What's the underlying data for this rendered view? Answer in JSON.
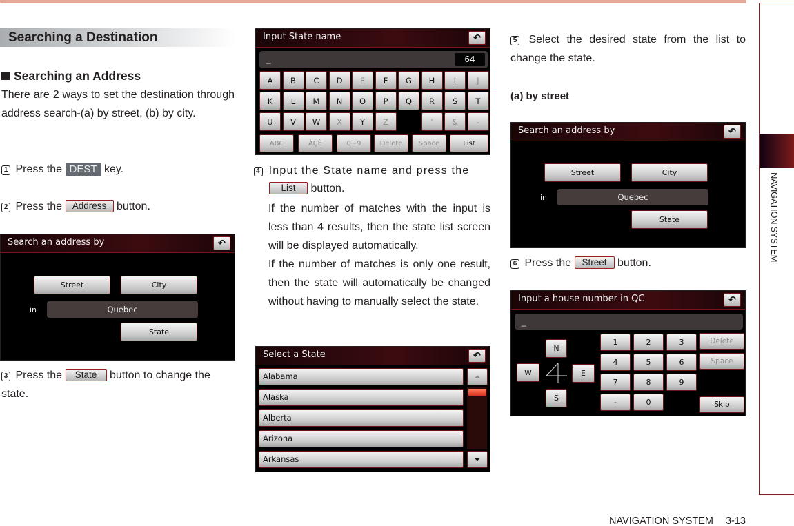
{
  "page": {
    "section_title": "Searching a Destination",
    "sub_heading": "Searching an Address",
    "intro": "There are 2 ways to set the destination through address search-(a) by street, (b) by city.",
    "side_label": "NAVIGATION SYSTEM",
    "footer": {
      "section": "NAVIGATION SYSTEM",
      "page": "3-13"
    },
    "accent_color": "#8b1a1a",
    "top_bar_color": "#e2a998"
  },
  "steps": [
    {
      "num": "1",
      "pre": "Press the",
      "key": "DEST",
      "post": "key."
    },
    {
      "num": "2",
      "pre": "Press the",
      "key": "Address",
      "post": "button."
    },
    {
      "num": "3",
      "pre": "Press the",
      "key": "State",
      "post": "button to change the state."
    },
    {
      "num": "4",
      "pre": "Input the State name and press the",
      "key": "List",
      "post": "button.",
      "note1": "If the number of matches with the input is less than 4 results, then the state list screen will be displayed automatically.",
      "note2": "If the number of matches is only one result, then the state will automatically be changed without having to manually select the state."
    },
    {
      "num": "5",
      "text": "Select the desired state from the list to change the state."
    },
    {
      "num": "6",
      "pre": "Press the",
      "key": "Street",
      "post": "button."
    }
  ],
  "by_street_label": "(a) by street",
  "screens": {
    "search_by": {
      "title": "Search an address by",
      "back_icon": "↶",
      "street": "Street",
      "city": "City",
      "in_label": "in",
      "region": "Quebec",
      "state": "State"
    },
    "input_state": {
      "title": "Input State name",
      "back_icon": "↶",
      "cursor": "_",
      "remaining": "64",
      "row1": [
        "A",
        "B",
        "C",
        "D",
        "E",
        "F",
        "G",
        "H",
        "I",
        "J"
      ],
      "row2": [
        "K",
        "L",
        "M",
        "N",
        "O",
        "P",
        "Q",
        "R",
        "S",
        "T"
      ],
      "row3": [
        "U",
        "V",
        "W",
        "X",
        "Y",
        "Z",
        "",
        "'",
        "&",
        "-"
      ],
      "row4": [
        "ABC",
        "ÀÇÈ",
        "0~9",
        "Delete",
        "Space",
        "List"
      ]
    },
    "select_state": {
      "title": "Select a State",
      "back_icon": "↶",
      "items": [
        "Alabama",
        "Alaska",
        "Alberta",
        "Arizona",
        "Arkansas"
      ],
      "scroll_up_icon": "⏶",
      "scroll_down_icon": "⏷"
    },
    "house_number": {
      "title": "Input a house number in QC",
      "back_icon": "↶",
      "cursor": "_",
      "north": "N",
      "south": "S",
      "east": "E",
      "west": "W",
      "keys": [
        "1",
        "2",
        "3",
        "4",
        "5",
        "6",
        "7",
        "8",
        "9",
        "-",
        "0"
      ],
      "delete": "Delete",
      "space": "Space",
      "skip": "Skip"
    }
  }
}
